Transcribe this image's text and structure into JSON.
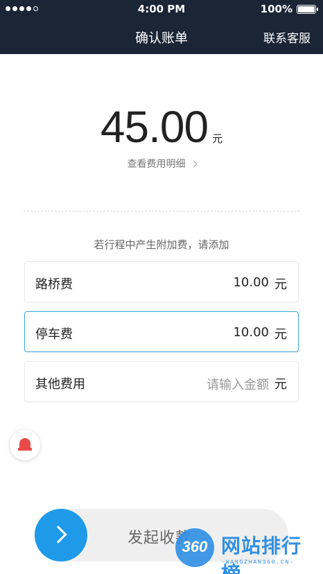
{
  "status_bar": {
    "time": "4:00 PM",
    "battery": "100%"
  },
  "header": {
    "title": "确认账单",
    "contact": "联系客服"
  },
  "amount": {
    "value": "45.00",
    "unit": "元"
  },
  "detail_link": "查看费用明细",
  "hint": "若行程中产生附加费，请添加",
  "fees": [
    {
      "label": "路桥费",
      "value": "10.00",
      "unit": "元"
    },
    {
      "label": "停车费",
      "value": "10.00",
      "unit": "元"
    },
    {
      "label": "其他费用",
      "placeholder": "请输入金额",
      "unit": "元"
    }
  ],
  "slider": {
    "label": "发起收款"
  },
  "watermark": {
    "logo": "360",
    "name": "网站排行榜",
    "url": "-WANGZHAN360.CN-"
  },
  "colors": {
    "header_bg": "#1a2535",
    "accent_blue": "#1e9ae8",
    "active_border": "#3aa7d8",
    "alarm_red": "#e94b4b"
  }
}
